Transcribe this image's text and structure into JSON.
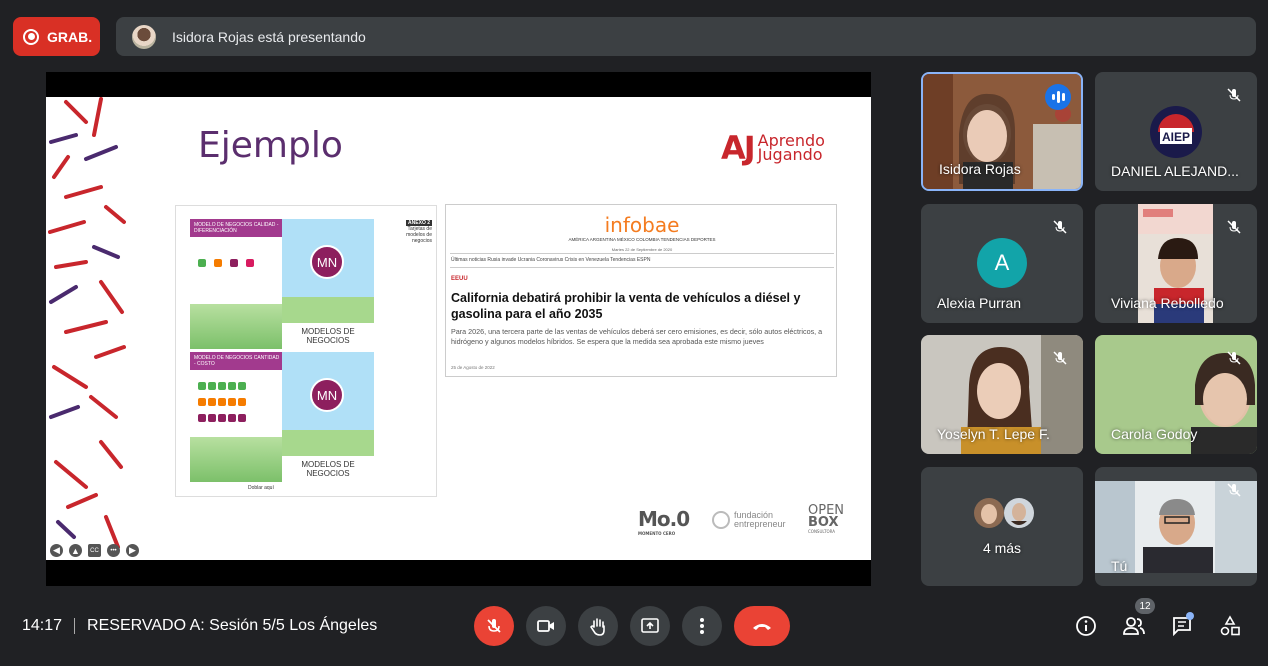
{
  "recording": {
    "label": "GRAB."
  },
  "presenting": {
    "text": "Isidora Rojas está presentando"
  },
  "slide": {
    "title": "Ejemplo",
    "logo_mark": "AJ",
    "logo_text_1": "Aprendo",
    "logo_text_2": "Jugando",
    "card_top_header": "MODELO DE NEGOCIOS CALIDAD - DIFERENCIACIÓN",
    "card_bottom_header": "MODELO DE NEGOCIOS CANTIDAD - COSTO",
    "mn": "MN",
    "modelos_label": "MODELOS DE NEGOCIOS",
    "anexo_badge": "ANEXO 2",
    "anexo_text": "Tarjetas de modelos de negocios",
    "doblar": "Doblar aquí",
    "news": {
      "logo": "infobae",
      "nav": "AMÉRICA  ARGENTINA  MÉXICO  COLOMBIA  TENDENCIAS  DEPORTES",
      "date": "Martes 22 de Septiembre de 2020",
      "subnav": "Últimas noticias     Rusia invade Ucrania     Coronavirus     Crisis en Venezuela     Tendencias     ESPN",
      "tag": "EEUU",
      "headline": "California debatirá prohibir la venta de vehículos a diésel y gasolina para el año 2035",
      "body": "Para 2026, una tercera parte de las ventas de vehículos deberá ser cero emisiones, es decir, sólo autos eléctricos, a hidrógeno y algunos modelos híbridos. Se espera que la medida sea aprobada este mismo jueves",
      "footer": "25 de Agosto de 2022"
    },
    "logo_moo": "Mo.0",
    "logo_moo_sub": "MOMENTO CERO",
    "logo_fund_1": "fundación",
    "logo_fund_2": "entrepreneur",
    "logo_open_1": "OPEN",
    "logo_open_2": "BOX",
    "logo_open_sub": "CONSULTORA",
    "controls": [
      "◀",
      "▲",
      "CC",
      "•••",
      "▶"
    ]
  },
  "participants": [
    {
      "name": "Isidora Rojas",
      "state": "speaking"
    },
    {
      "name": "DANIEL ALEJAND...",
      "state": "muted"
    },
    {
      "name": "Alexia Purran",
      "state": "muted",
      "initial": "A"
    },
    {
      "name": "Viviana Rebolledo",
      "state": "muted"
    },
    {
      "name": "Yoselyn T. Lepe F.",
      "state": "muted"
    },
    {
      "name": "Carola Godoy",
      "state": "muted"
    },
    {
      "name": "4 más",
      "state": "group"
    },
    {
      "name": "Tú",
      "state": "muted"
    }
  ],
  "bottom": {
    "time": "14:17",
    "meeting": "RESERVADO A: Sesión 5/5 Los Ángeles",
    "people_count": "12"
  },
  "colors": {
    "accent": "#8ab4f8",
    "red": "#ea4335",
    "tile": "#3c4043",
    "bg": "#202124"
  }
}
